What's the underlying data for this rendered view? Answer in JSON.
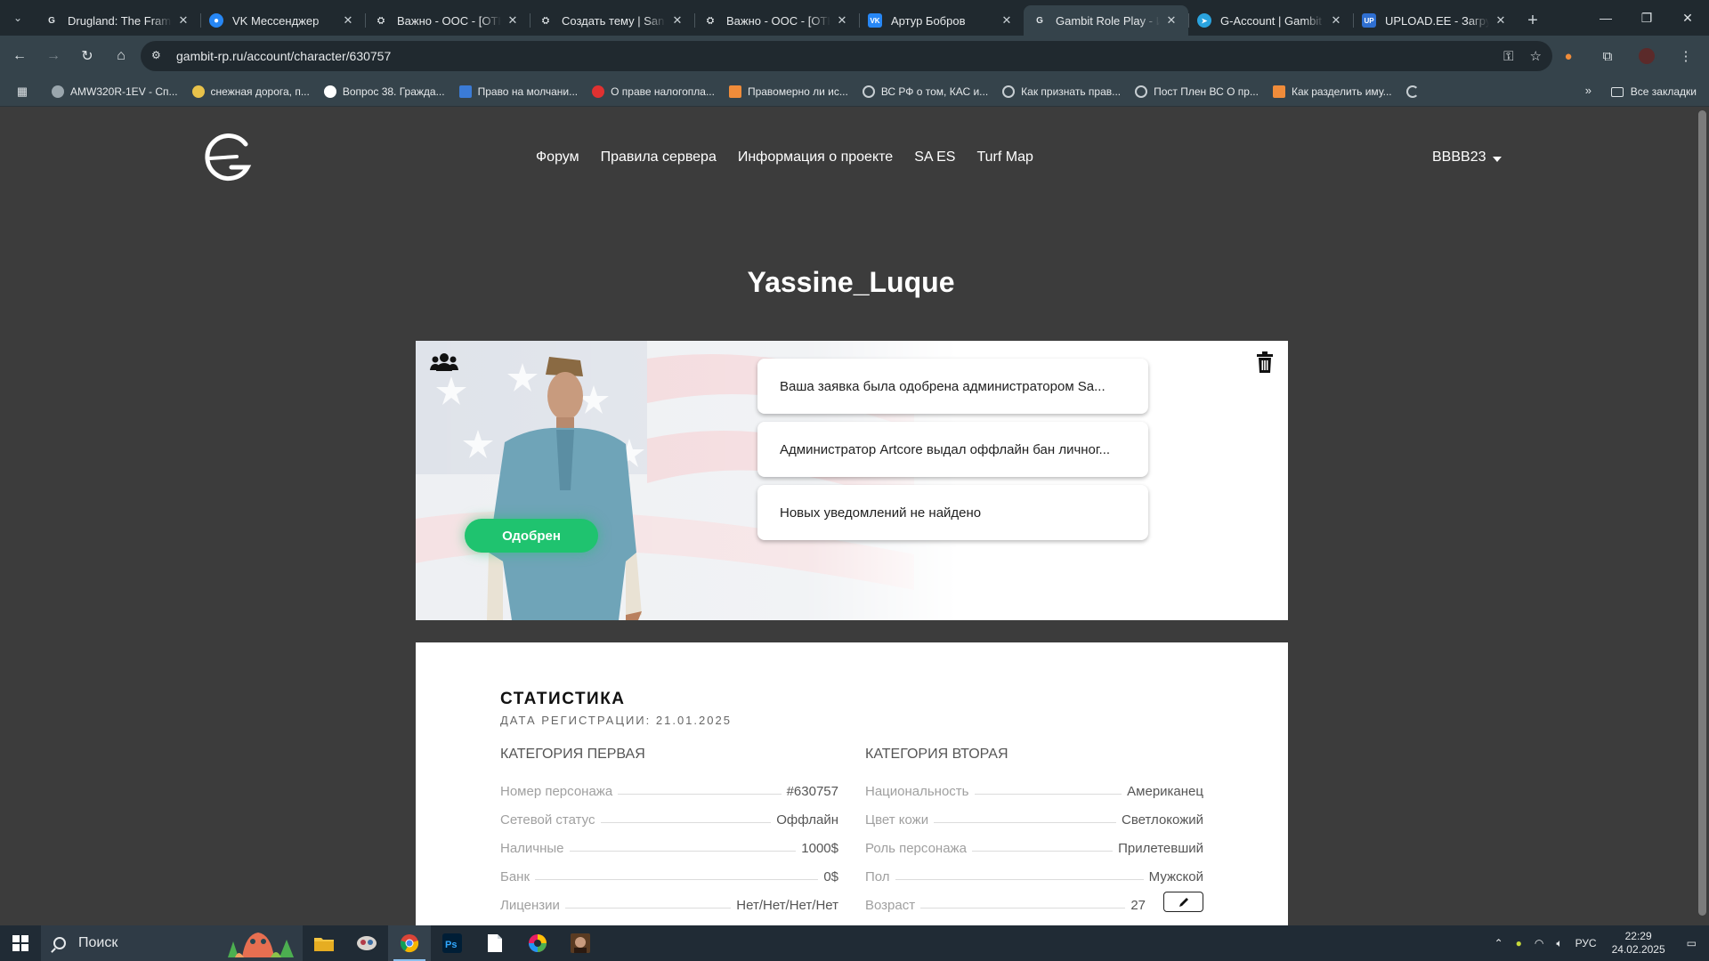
{
  "browser": {
    "tabs": [
      {
        "title": "Drugland: The Fram' (",
        "favicon": "gambit",
        "active": false
      },
      {
        "title": "VK Мессенджер",
        "favicon": "vk-messenger",
        "active": false
      },
      {
        "title": "Важно - ООС - [ОТК",
        "favicon": "forum",
        "active": false
      },
      {
        "title": "Создать тему | San A",
        "favicon": "forum",
        "active": false
      },
      {
        "title": "Важно - ООС - [ОТК",
        "favicon": "forum",
        "active": false
      },
      {
        "title": "Артур Бобров",
        "favicon": "vk",
        "active": false
      },
      {
        "title": "Gambit Role Play - И",
        "favicon": "gambit",
        "active": true
      },
      {
        "title": "G-Account | Gambit F",
        "favicon": "telegram",
        "active": false
      },
      {
        "title": "UPLOAD.EE - Загрузк",
        "favicon": "upload",
        "active": false
      }
    ],
    "url": "gambit-rp.ru/account/character/630757",
    "bookmarks": [
      {
        "label": "AMW320R-1EV - Сп...",
        "color": "#9aa6ad"
      },
      {
        "label": "снежная дорога, п...",
        "color": "#e8c24a"
      },
      {
        "label": "Вопрос 38. Гражда...",
        "color": "#ffffff"
      },
      {
        "label": "Право на молчани...",
        "color": "#3b7bd6"
      },
      {
        "label": "О праве налогопла...",
        "color": "#e03131"
      },
      {
        "label": "Правомерно ли ис...",
        "color": "#f08c3a"
      },
      {
        "label": "ВС РФ о том, КАС и...",
        "color": "#c7ced2"
      },
      {
        "label": "Как признать прав...",
        "color": "#c7ced2"
      },
      {
        "label": "Пост Плен ВС О пр...",
        "color": "#c7ced2"
      },
      {
        "label": "Как разделить иму...",
        "color": "#f08c3a"
      }
    ],
    "all_bookmarks_label": "Все закладки"
  },
  "site": {
    "nav": [
      "Форум",
      "Правила сервера",
      "Информация о проекте",
      "SA ES",
      "Turf Map"
    ],
    "username": "BBBB23"
  },
  "character": {
    "name": "Yassine_Luque",
    "status": "Одобрен",
    "status_color": "#1fc36f",
    "notifications": [
      "Ваша заявка была одобрена администратором Sa...",
      "Администратор Artcore выдал оффлайн бан личног...",
      "Новых уведомлений не найдено"
    ]
  },
  "stats": {
    "title": "СТАТИСТИКА",
    "reg_date": "ДАТА РЕГИСТРАЦИИ: 21.01.2025",
    "category_1": {
      "title": "КАТЕГОРИЯ ПЕРВАЯ",
      "rows": [
        {
          "label": "Номер персонажа",
          "value": "#630757"
        },
        {
          "label": "Сетевой статус",
          "value": "Оффлайн"
        },
        {
          "label": "Наличные",
          "value": "1000$"
        },
        {
          "label": "Банк",
          "value": "0$"
        },
        {
          "label": "Лицензии",
          "value": "Нет/Нет/Нет/Нет"
        }
      ]
    },
    "category_2": {
      "title": "КАТЕГОРИЯ ВТОРАЯ",
      "rows": [
        {
          "label": "Национальность",
          "value": "Американец"
        },
        {
          "label": "Цвет кожи",
          "value": "Светлокожий"
        },
        {
          "label": "Роль персонажа",
          "value": "Прилетевший"
        },
        {
          "label": "Пол",
          "value": "Мужской"
        },
        {
          "label": "Возраст",
          "value": "27"
        }
      ]
    }
  },
  "taskbar": {
    "search_placeholder": "Поиск",
    "language": "РУС",
    "time": "22:29",
    "date": "24.02.2025"
  }
}
